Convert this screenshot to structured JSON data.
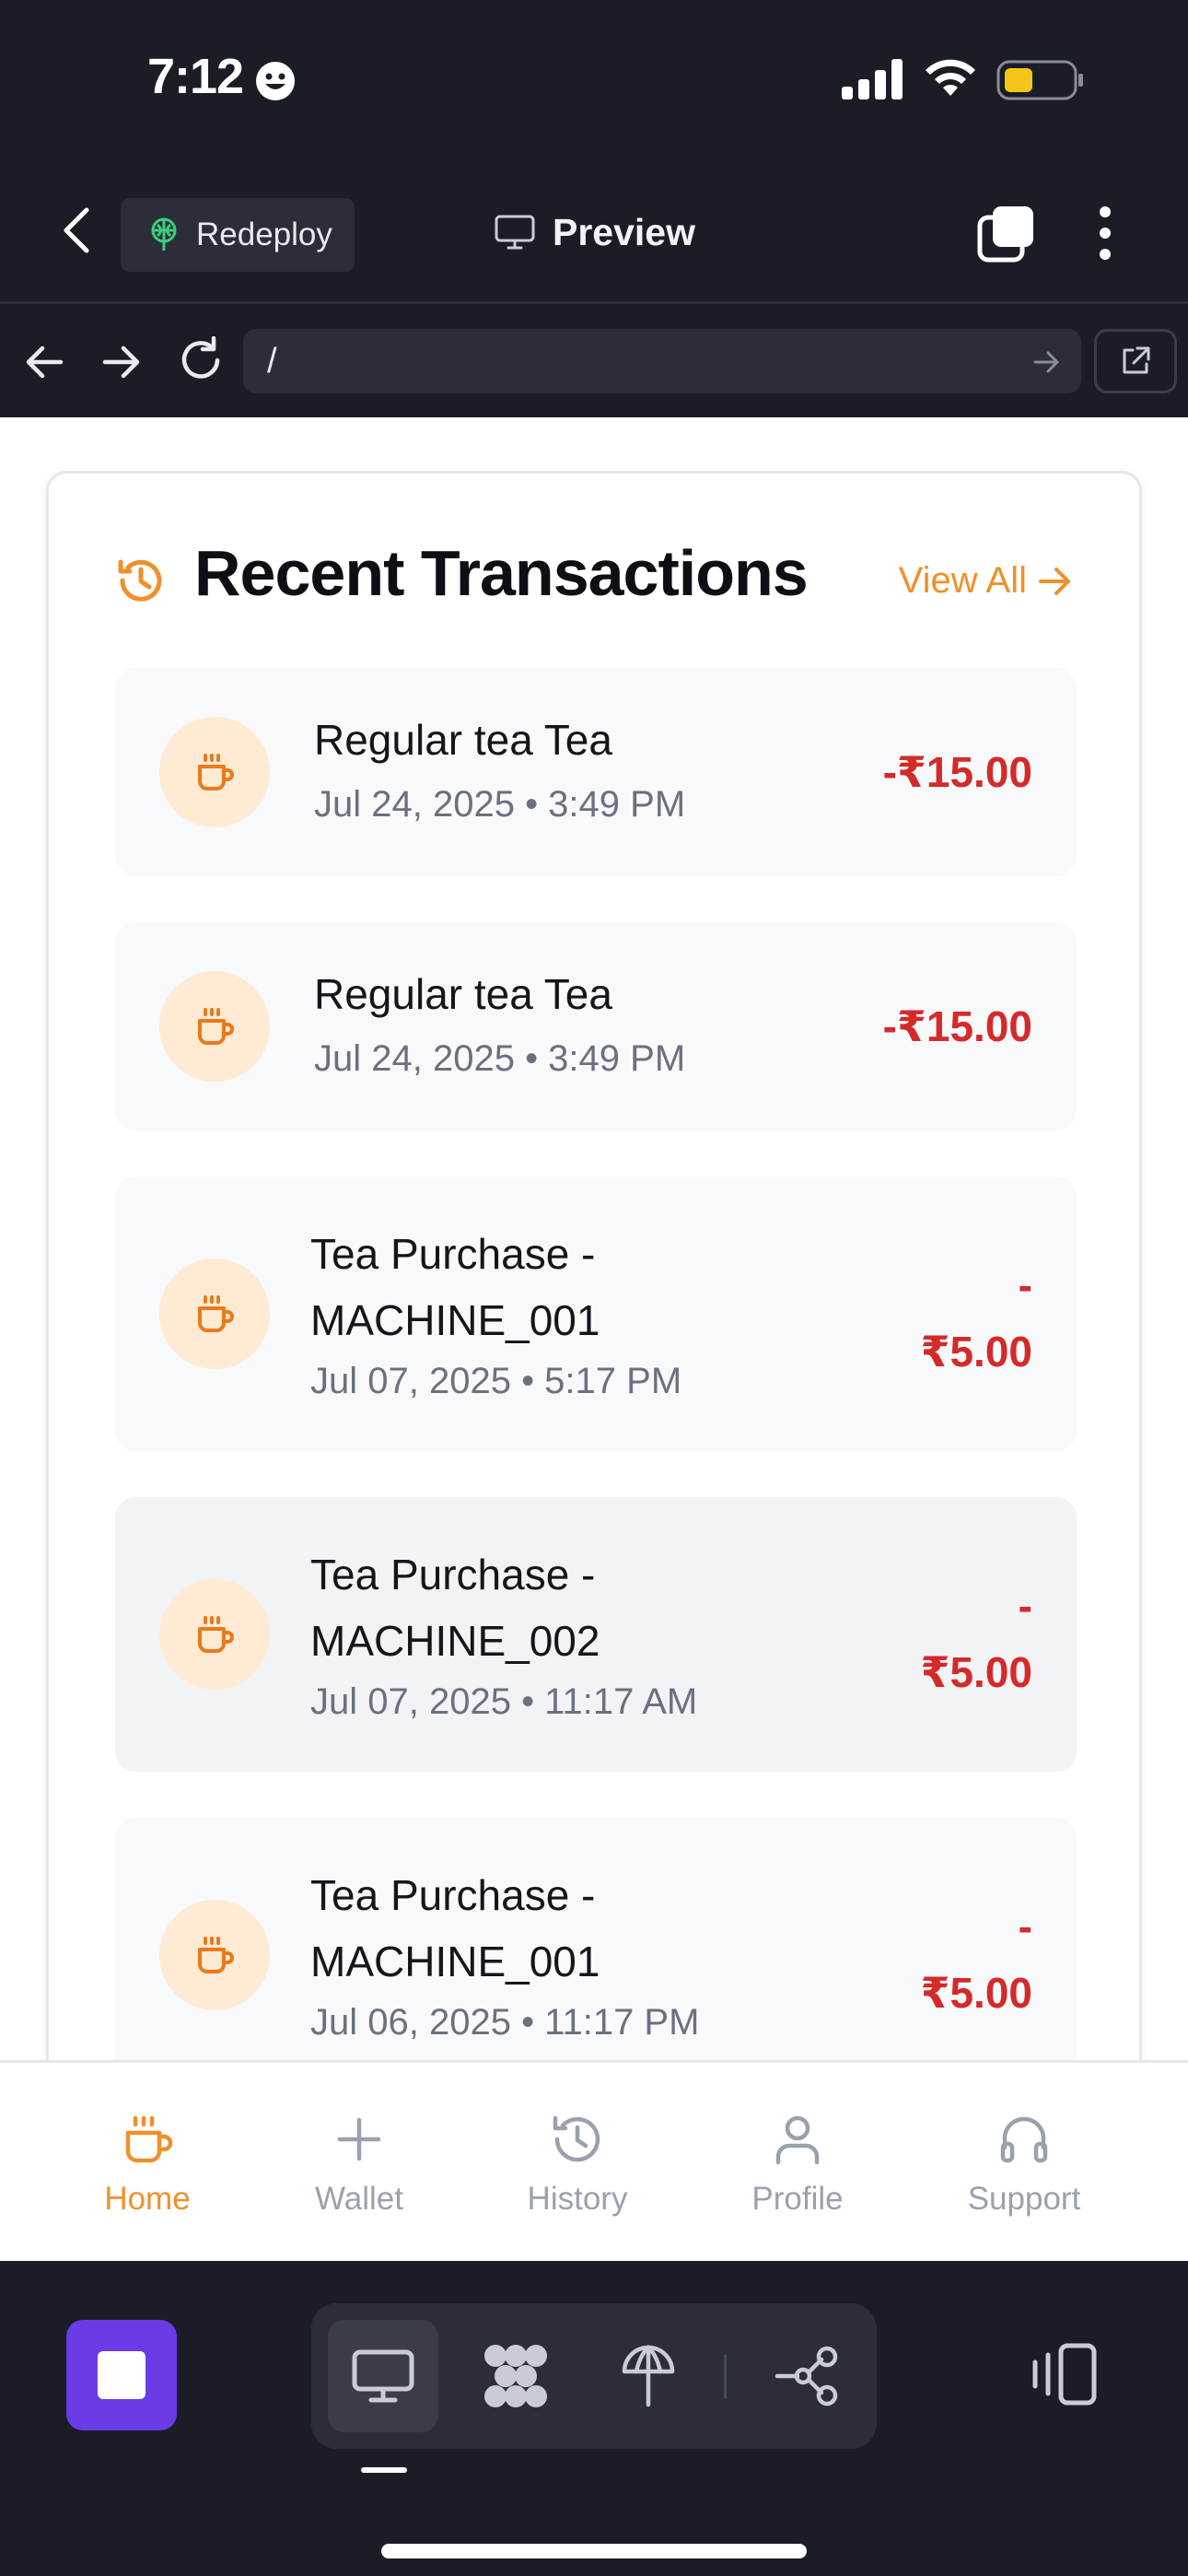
{
  "status_bar": {
    "time": "7:12",
    "battery_color": "#f5c518"
  },
  "header": {
    "back_icon": "chevron-left-icon",
    "redeploy_label": "Redeploy",
    "preview_label": "Preview"
  },
  "browser": {
    "url": "/"
  },
  "transactions": {
    "title": "Recent Transactions",
    "view_all_label": "View All",
    "accent_color": "#f0902a",
    "amount_color": "#d42a2a",
    "items": [
      {
        "name": "Regular tea Tea",
        "date": "Jul 24, 2025 • 3:49 PM",
        "amount": "-₹15.00",
        "icon": "coffee-cup-icon"
      },
      {
        "name": "Regular tea Tea",
        "date": "Jul 24, 2025 • 3:49 PM",
        "amount": "-₹15.00",
        "icon": "coffee-cup-icon"
      },
      {
        "name_line1": "Tea Purchase -",
        "name_line2": "MACHINE_001",
        "date": "Jul 07, 2025 • 5:17 PM",
        "amount_line1": "-",
        "amount_line2": "₹5.00",
        "icon": "coffee-cup-icon"
      },
      {
        "name_line1": "Tea Purchase -",
        "name_line2": "MACHINE_002",
        "date": "Jul 07, 2025 • 11:17 AM",
        "amount_line1": "-",
        "amount_line2": "₹5.00",
        "icon": "coffee-cup-icon"
      },
      {
        "name_line1": "Tea Purchase -",
        "name_line2": "MACHINE_001",
        "date": "Jul 06, 2025 • 11:17 PM",
        "amount_line1": "-",
        "amount_line2": "₹5.00",
        "icon": "coffee-cup-icon"
      }
    ]
  },
  "tabbar": {
    "tabs": [
      {
        "label": "Home",
        "icon": "coffee-cup-icon",
        "active": true
      },
      {
        "label": "Wallet",
        "icon": "plus-icon",
        "active": false
      },
      {
        "label": "History",
        "icon": "history-icon",
        "active": false
      },
      {
        "label": "Profile",
        "icon": "user-icon",
        "active": false
      },
      {
        "label": "Support",
        "icon": "headphones-icon",
        "active": false
      }
    ]
  },
  "toolbar": {
    "stop_color": "#6b3ce6",
    "tools": [
      "monitor-icon",
      "extensions-icon",
      "deploy-icon",
      "workflow-icon"
    ]
  }
}
